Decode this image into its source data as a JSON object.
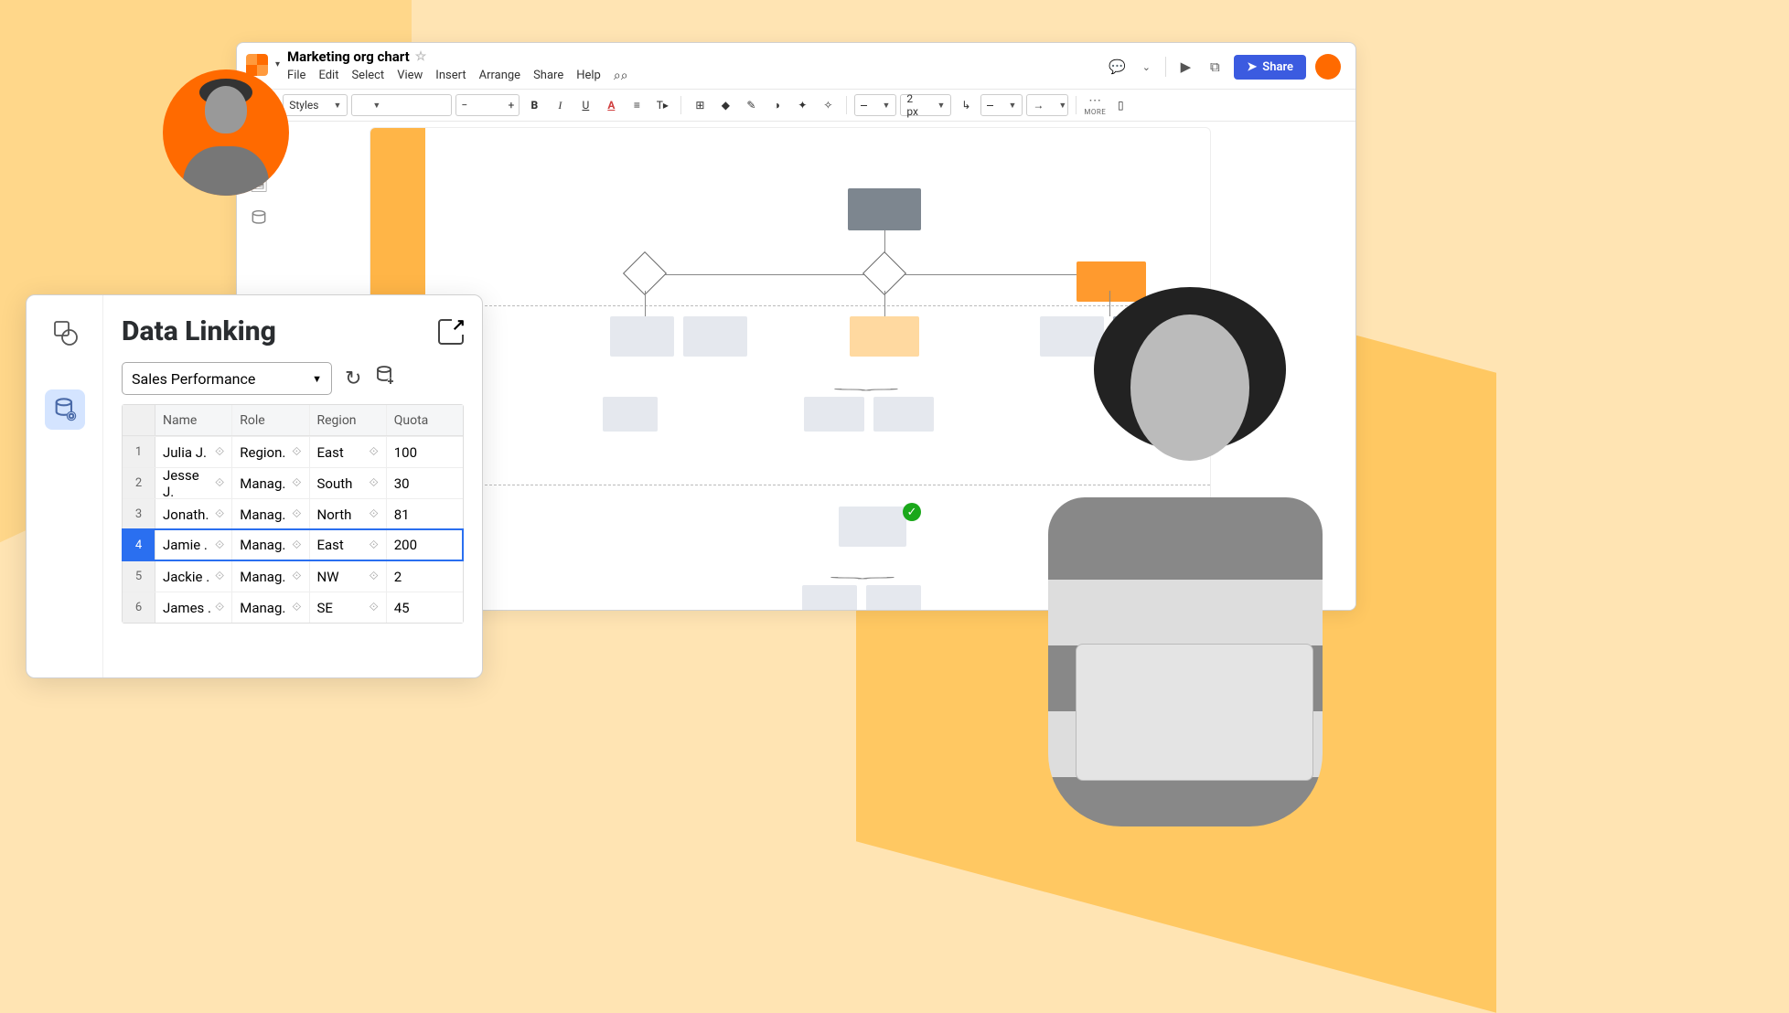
{
  "document": {
    "title": "Marketing org chart"
  },
  "menubar": {
    "file": "File",
    "edit": "Edit",
    "select": "Select",
    "view": "View",
    "insert": "Insert",
    "arrange": "Arrange",
    "share": "Share",
    "help": "Help"
  },
  "titlebarActions": {
    "share": "Share"
  },
  "toolbar": {
    "styles_label": "Styles",
    "stroke_width": "2 px",
    "more_label": "MORE"
  },
  "panel": {
    "title": "Data Linking",
    "datasource": "Sales Performance",
    "columns": {
      "name": "Name",
      "role": "Role",
      "region": "Region",
      "quota": "Quota"
    },
    "rows": [
      {
        "num": "1",
        "name": "Julia J.",
        "role": "Region.",
        "region": "East",
        "quota": "100"
      },
      {
        "num": "2",
        "name": "Jesse J.",
        "role": "Manag.",
        "region": "South",
        "quota": "30"
      },
      {
        "num": "3",
        "name": "Jonath.",
        "role": "Manag.",
        "region": "North",
        "quota": "81"
      },
      {
        "num": "4",
        "name": "Jamie .",
        "role": "Manag.",
        "region": "East",
        "quota": "200"
      },
      {
        "num": "5",
        "name": "Jackie .",
        "role": "Manag.",
        "region": "NW",
        "quota": "2"
      },
      {
        "num": "6",
        "name": "James .",
        "role": "Manag.",
        "region": "SE",
        "quota": "45"
      }
    ],
    "selected_row_index": 3
  }
}
